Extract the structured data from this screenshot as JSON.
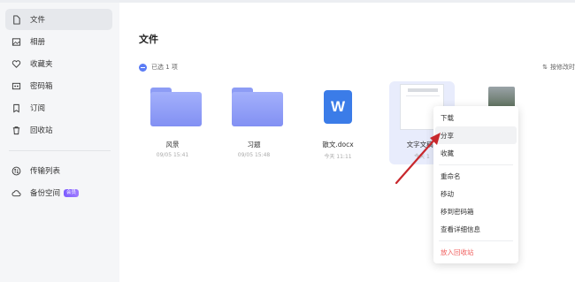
{
  "sidebar": {
    "items": [
      {
        "label": "文件",
        "icon": "file-icon",
        "active": true
      },
      {
        "label": "相册",
        "icon": "photo-icon",
        "active": false
      },
      {
        "label": "收藏夹",
        "icon": "heart-icon",
        "active": false
      },
      {
        "label": "密码箱",
        "icon": "safe-icon",
        "active": false
      },
      {
        "label": "订阅",
        "icon": "bookmark-icon",
        "active": false
      },
      {
        "label": "回收站",
        "icon": "trash-icon",
        "active": false
      }
    ],
    "transfer_label": "传输列表",
    "backup_label": "备份空间",
    "backup_badge": "会员"
  },
  "main": {
    "title": "文件",
    "selected_text": "已选 1 项",
    "sort_label": "按修改时"
  },
  "files": [
    {
      "name": "风景",
      "date": "09/05 15:41",
      "type": "folder"
    },
    {
      "name": "习题",
      "date": "09/05 15:48",
      "type": "folder"
    },
    {
      "name": "散文.docx",
      "date": "今天 11:11",
      "type": "word",
      "icon_letter": "W"
    },
    {
      "name": "文字文稿1",
      "date": "今天 1",
      "type": "doc",
      "selected": true
    },
    {
      "name": "",
      "date": "",
      "type": "image"
    }
  ],
  "context_menu": {
    "items": [
      "下载",
      "分享",
      "收藏",
      "重命名",
      "移动",
      "移到密码箱",
      "查看详细信息",
      "放入回收站"
    ],
    "hover_index": 1,
    "danger_index": 7
  },
  "colors": {
    "accent": "#5b7cf5",
    "arrow": "#c8282d",
    "danger": "#f0605f",
    "word": "#3b7ce8"
  }
}
